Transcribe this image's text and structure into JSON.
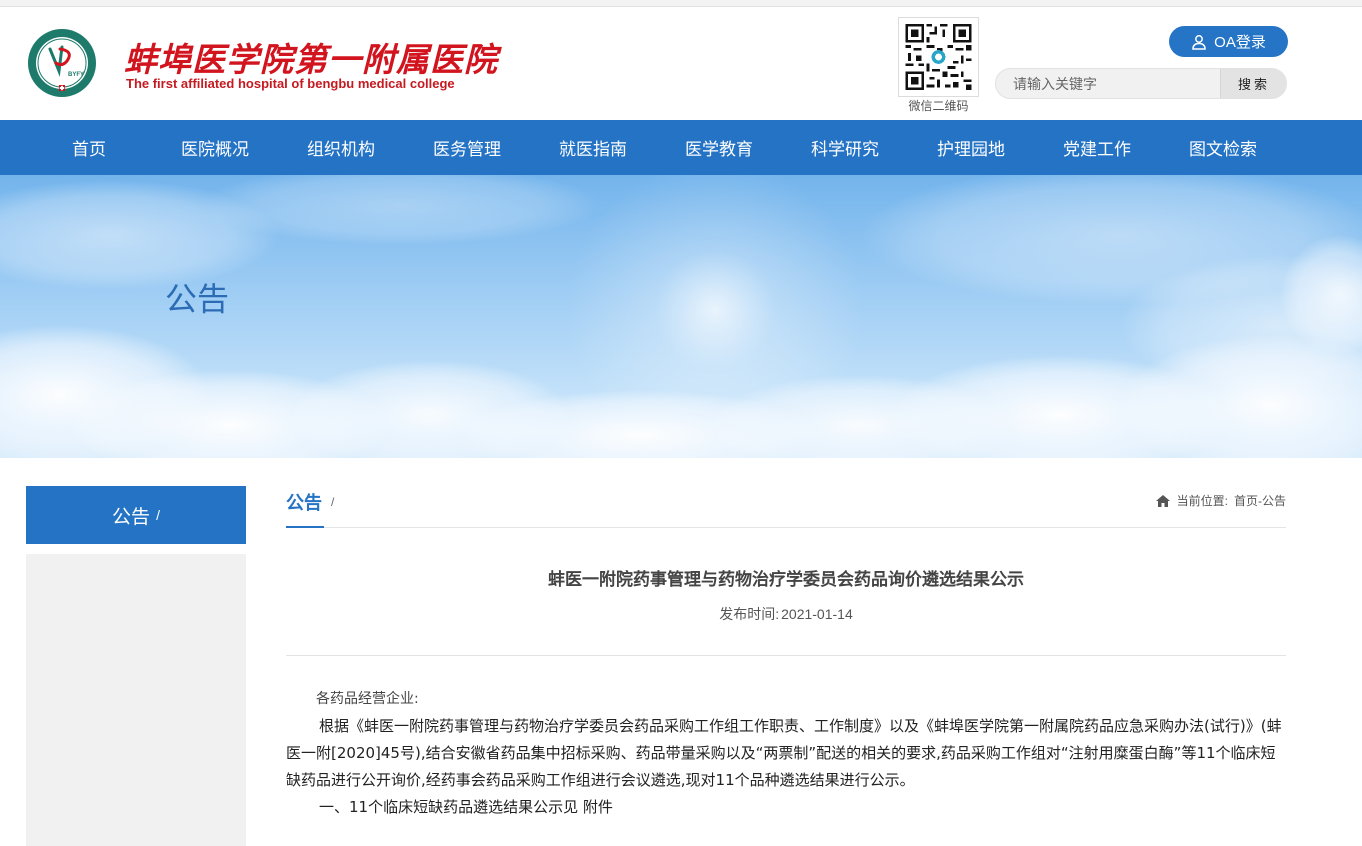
{
  "header": {
    "hospital_name_cn": "蚌埠医学院第一附属医院",
    "hospital_name_en": "The first affiliated hospital of bengbu medical college",
    "logo_text": "BYFY",
    "qr_caption": "微信二维码",
    "oa_login_label": "OA登录",
    "search_placeholder": "请输入关键字",
    "search_button_label": "搜索"
  },
  "nav": {
    "items": [
      "首页",
      "医院概况",
      "组织机构",
      "医务管理",
      "就医指南",
      "医学教育",
      "科学研究",
      "护理园地",
      "党建工作",
      "图文检索"
    ]
  },
  "banner": {
    "title": "公告"
  },
  "sidebar": {
    "title": "公告",
    "slash": "/"
  },
  "content": {
    "section_title": "公告",
    "section_slash": "/",
    "breadcrumb_label": "当前位置:",
    "breadcrumb_path": "首页-公告",
    "article_title": "蚌医一附院药事管理与药物治疗学委员会药品询价遴选结果公示",
    "publish_label": "发布时间:",
    "publish_date": "2021-01-14",
    "greeting": "各药品经营企业:",
    "paragraph": "根据《蚌医一附院药事管理与药物治疗学委员会药品采购工作组工作职责、工作制度》以及《蚌埠医学院第一附属院药品应急采购办法(试行)》(蚌医一附[2020]45号),结合安徽省药品集中招标采购、药品带量采购以及“两票制”配送的相关的要求,药品采购工作组对“注射用糜蛋白酶”等11个临床短缺药品进行公开询价,经药事会药品采购工作组进行会议遴选,现对11个品种遴选结果进行公示。",
    "item_1": "一、11个临床短缺药品遴选结果公示见 附件"
  },
  "colors": {
    "brand_blue": "#2473c5",
    "brand_red": "#d2141e",
    "logo_green": "#1e7a6a"
  }
}
